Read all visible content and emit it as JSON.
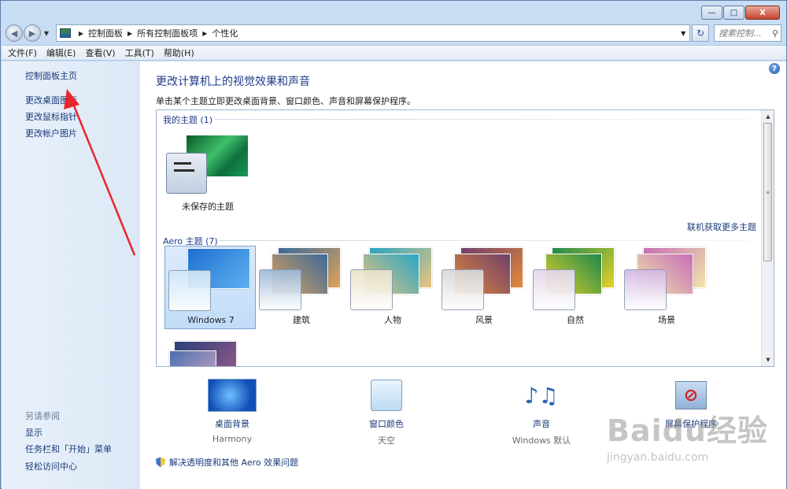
{
  "window": {
    "minimize_glyph": "—",
    "maximize_glyph": "□",
    "close_glyph": "X"
  },
  "addressbar": {
    "back_glyph": "◀",
    "forward_glyph": "▶",
    "dropdown_glyph": "▼",
    "crumbs": [
      "控制面板",
      "所有控制面板项",
      "个性化"
    ],
    "crumb_sep": "▶",
    "refresh_glyph": "↻",
    "search_placeholder": "搜索控制...",
    "search_glyph": "⚲"
  },
  "menubar": {
    "items": [
      "文件(F)",
      "编辑(E)",
      "查看(V)",
      "工具(T)",
      "帮助(H)"
    ]
  },
  "sidebar": {
    "links": [
      "控制面板主页",
      "更改桌面图标",
      "更改鼠标指针",
      "更改帐户图片"
    ],
    "see_also_heading": "另请参阅",
    "see_also_links": [
      "显示",
      "任务栏和「开始」菜单",
      "轻松访问中心"
    ]
  },
  "content": {
    "help_glyph": "?",
    "title": "更改计算机上的视觉效果和声音",
    "description": "单击某个主题立即更改桌面背景、窗口颜色、声音和屏幕保护程序。",
    "my_themes_heading": "我的主题 (1)",
    "unsaved_theme_label": "未保存的主题",
    "online_link": "联机获取更多主题",
    "aero_heading": "Aero 主题 (7)",
    "aero_themes": [
      {
        "label": "Windows 7",
        "selected": true,
        "colors": [
          "#1d6fd1",
          "#5fb1f0"
        ],
        "swatch": "#cfe6f8"
      },
      {
        "label": "建筑",
        "selected": false,
        "colors": [
          "#3b6a9b",
          "#e0a25a"
        ],
        "swatch": "#9cb8d6"
      },
      {
        "label": "人物",
        "selected": false,
        "colors": [
          "#2aa6c4",
          "#e9c47d"
        ],
        "swatch": "#e9e2c7"
      },
      {
        "label": "风景",
        "selected": false,
        "colors": [
          "#6f3f6b",
          "#e38a3a"
        ],
        "swatch": "#d8d8d8"
      },
      {
        "label": "自然",
        "selected": false,
        "colors": [
          "#1d8a4a",
          "#e6d12a"
        ],
        "swatch": "#e4d6ec"
      },
      {
        "label": "场景",
        "selected": false,
        "colors": [
          "#c86fb8",
          "#f0e6a8"
        ],
        "swatch": "#d4b8e4"
      }
    ],
    "scroll_up_glyph": "▲",
    "scroll_down_glyph": "▼",
    "scroll_grip_glyph": "≡"
  },
  "bottom": {
    "items": [
      {
        "label": "桌面背景",
        "sub": "Harmony"
      },
      {
        "label": "窗口颜色",
        "sub": "天空"
      },
      {
        "label": "声音",
        "sub": "Windows 默认"
      },
      {
        "label": "屏幕保护程序",
        "sub": ""
      }
    ],
    "sound_glyph": "♪♫",
    "screensaver_glyph": "⊘"
  },
  "aero_link": "解决透明度和其他 Aero 效果问题",
  "watermark": {
    "logo": "Baidu经验",
    "url": "jingyan.baidu.com"
  }
}
